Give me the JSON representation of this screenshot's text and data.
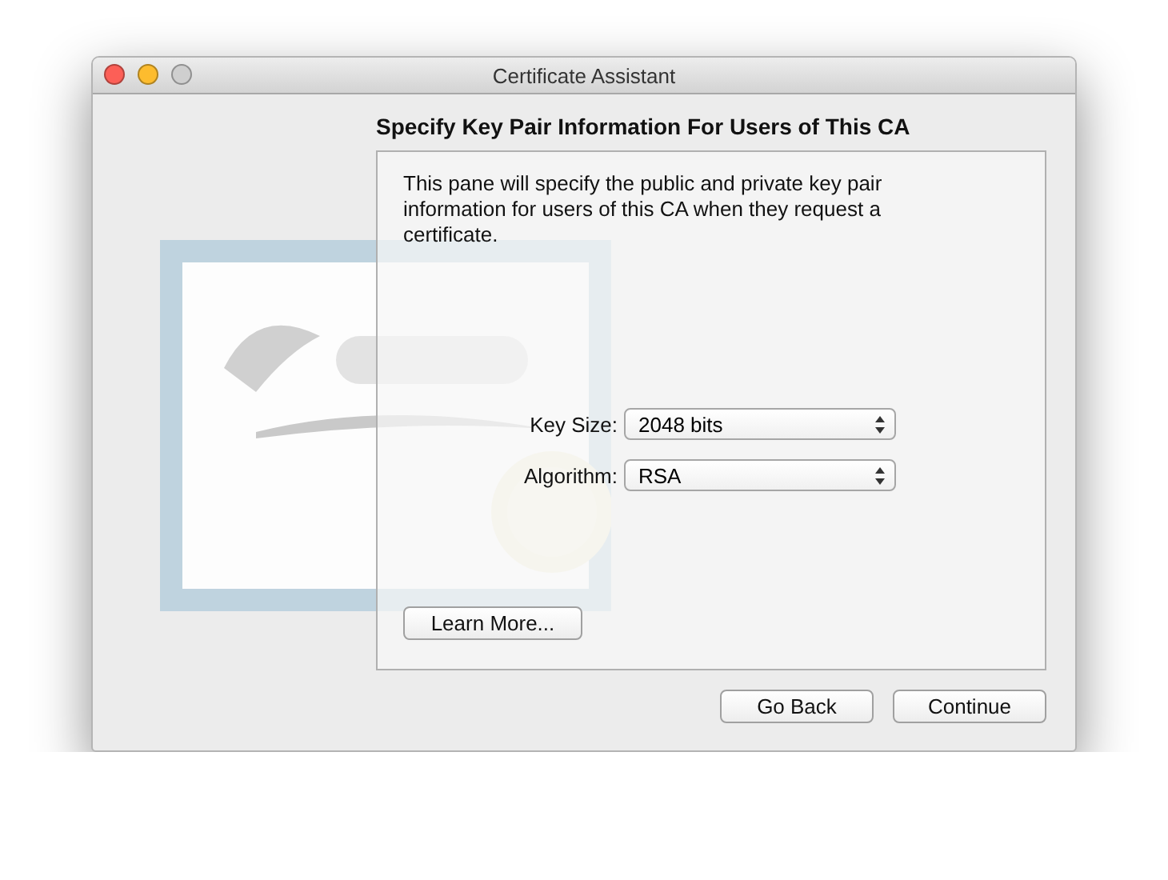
{
  "window": {
    "title": "Certificate Assistant"
  },
  "heading": "Specify Key Pair Information For Users of This CA",
  "description": "This pane will specify the public and private key pair information for users of this CA when they request a certificate.",
  "fields": [
    {
      "label": "Key Size:",
      "value": "2048 bits"
    },
    {
      "label": "Algorithm:",
      "value": "RSA"
    }
  ],
  "learn_more": "Learn More...",
  "buttons": [
    {
      "label": "Go Back"
    },
    {
      "label": "Continue"
    }
  ]
}
